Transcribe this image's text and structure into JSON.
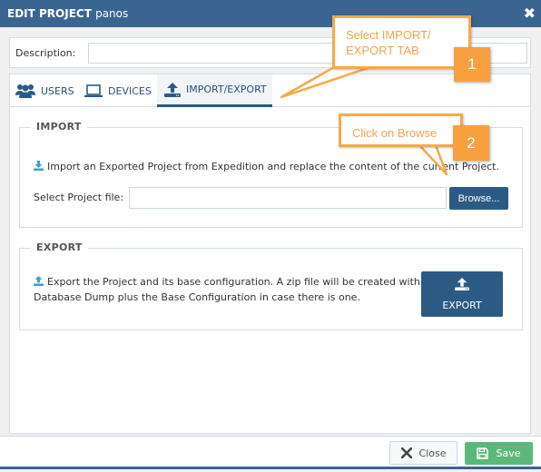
{
  "dialog": {
    "title_prefix": "EDIT PROJECT",
    "project_name": "panos",
    "close_icon": "times-icon"
  },
  "description": {
    "label": "Description:",
    "value": "",
    "placeholder": ""
  },
  "tabs": [
    {
      "label": "USERS",
      "icon": "users-icon",
      "active": false
    },
    {
      "label": "DEVICES",
      "icon": "laptop-icon",
      "active": false
    },
    {
      "label": "IMPORT/EXPORT",
      "icon": "upload-icon",
      "active": true
    }
  ],
  "import": {
    "legend": "IMPORT",
    "description": "Import an Exported Project from Expedition and replace the content of the current Project.",
    "file_label": "Select Project file:",
    "file_value": "",
    "browse_label": "Browse..."
  },
  "export": {
    "legend": "EXPORT",
    "description_line1": "Export the Project and its base configuration. A zip file will be created with the",
    "description_line2": "Database Dump plus the Base Configuration in case there is one.",
    "button_label": "EXPORT"
  },
  "footer": {
    "close_label": "Close",
    "save_label": "Save"
  },
  "annotations": [
    {
      "step": "1",
      "line1": "Select IMPORT/",
      "line2": "EXPORT TAB"
    },
    {
      "step": "2",
      "text": "Click on Browse"
    }
  ],
  "colors": {
    "header": "#3a6591",
    "primary_button": "#2b5a85",
    "save_button": "#5cb87a",
    "callout": "#f6a94a"
  }
}
